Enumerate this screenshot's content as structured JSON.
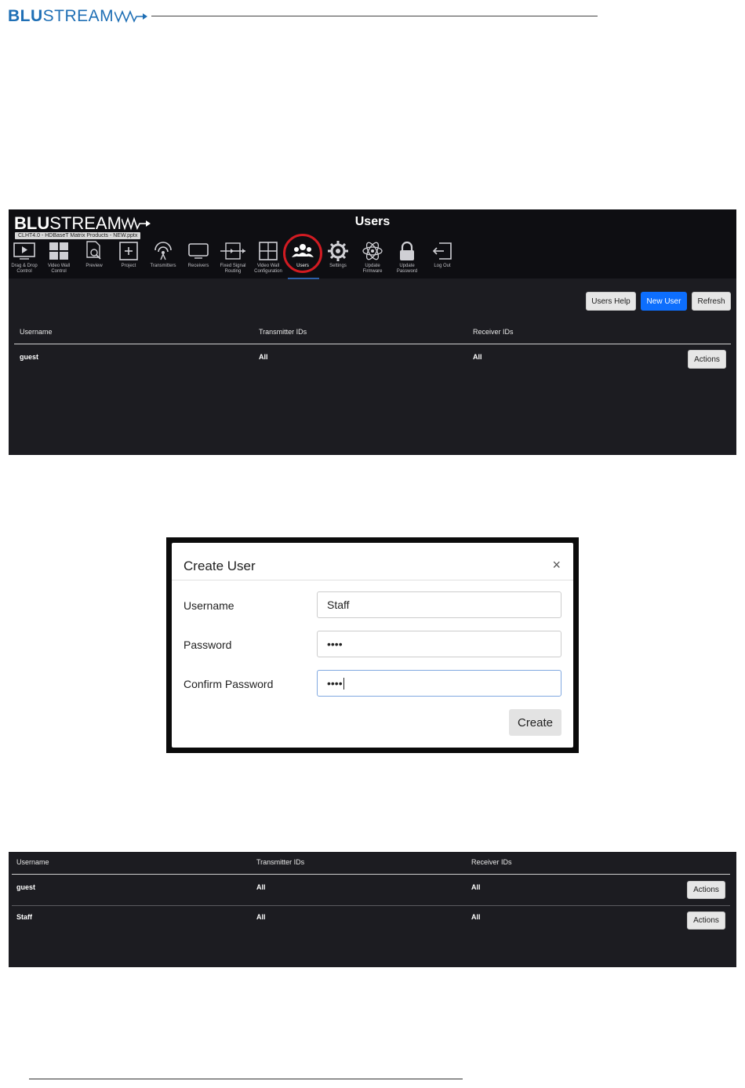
{
  "doc_header": {
    "logo_bold": "BLU",
    "logo_rest": "STREAM"
  },
  "app": {
    "logo_bold": "BLU",
    "logo_rest": "STREAM",
    "tooltip": "CLHT4.0 - HDBaseT Matrix Products - NEW.pptx",
    "page_title": "Users",
    "nav": [
      {
        "label": "Drag & Drop Control",
        "icon": "play-screen-icon"
      },
      {
        "label": "Video Wall Control",
        "icon": "video-wall-grid-icon"
      },
      {
        "label": "Preview",
        "icon": "preview-search-icon"
      },
      {
        "label": "Project",
        "icon": "project-plus-icon"
      },
      {
        "label": "Transmitters",
        "icon": "antenna-icon"
      },
      {
        "label": "Receivers",
        "icon": "monitor-icon"
      },
      {
        "label": "Fixed Signal Routing",
        "icon": "routing-icon"
      },
      {
        "label": "Video Wall Configuration",
        "icon": "grid-icon"
      },
      {
        "label": "Users",
        "icon": "users-icon"
      },
      {
        "label": "Settings",
        "icon": "gear-icon"
      },
      {
        "label": "Update Firmware",
        "icon": "atom-icon"
      },
      {
        "label": "Update Password",
        "icon": "lock-icon"
      },
      {
        "label": "Log Out",
        "icon": "logout-icon"
      }
    ],
    "buttons": {
      "help": "Users Help",
      "new_user": "New User",
      "refresh": "Refresh"
    },
    "table": {
      "headers": [
        "Username",
        "Transmitter IDs",
        "Receiver IDs"
      ],
      "rows": [
        {
          "username": "guest",
          "transmitters": "All",
          "receivers": "All",
          "action": "Actions"
        }
      ]
    }
  },
  "modal": {
    "title": "Create User",
    "close": "×",
    "fields": [
      {
        "label": "Username",
        "value": "Staff"
      },
      {
        "label": "Password",
        "value": "••••"
      },
      {
        "label": "Confirm Password",
        "value": "••••"
      }
    ],
    "submit": "Create"
  },
  "result_table": {
    "headers": [
      "Username",
      "Transmitter IDs",
      "Receiver IDs"
    ],
    "rows": [
      {
        "username": "guest",
        "transmitters": "All",
        "receivers": "All",
        "action": "Actions"
      },
      {
        "username": "Staff",
        "transmitters": "All",
        "receivers": "All",
        "action": "Actions"
      }
    ]
  }
}
